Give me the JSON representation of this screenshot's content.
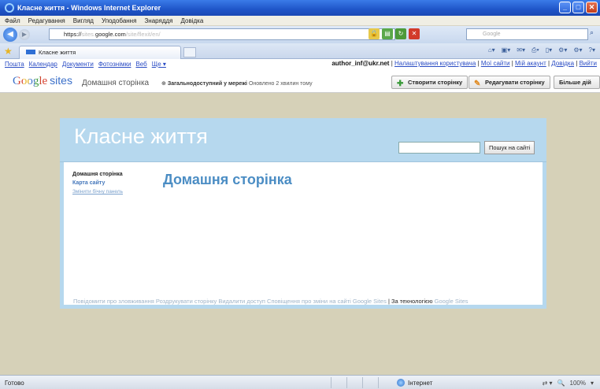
{
  "window": {
    "title": "Класне життя - Windows Internet Explorer",
    "controls": {
      "minimize": "_",
      "maximize": "□",
      "close": "✕"
    }
  },
  "menu": [
    "Файл",
    "Редагування",
    "Вигляд",
    "Уподобання",
    "Знаряддя",
    "Довідка"
  ],
  "address": {
    "scheme": "https://",
    "host_dim": "sites.",
    "host": "google.com",
    "path_dim": "/site/flexit/en/",
    "search_placeholder": "Google"
  },
  "tab": {
    "label": "Класне життя"
  },
  "google_bar": {
    "links": [
      "Пошта",
      "Календар",
      "Документи",
      "Фотознімки",
      "Веб",
      "Ще ▾"
    ],
    "user": "author_inf@ukr.net",
    "right_links": [
      "Налаштування користувача",
      "Мої сайти",
      "Мій акаунт",
      "Довідка",
      "Вийти"
    ]
  },
  "sites_bar": {
    "logo_google": "Google",
    "logo_sites": "sites",
    "home_label": "Домашня сторінка",
    "public_label": "Загальнодоступний у мережі",
    "updated": "Оновлено 2 хвилин тому",
    "create_button": "Створити сторінку",
    "edit_button": "Редагувати сторінку",
    "more_button": "Більше дій ▾"
  },
  "site": {
    "title": "Класне життя",
    "search_button": "Пошук на сайті",
    "nav": {
      "current": "Домашня сторінка",
      "sitemap": "Карта сайту",
      "edit_sidebar": "Змінити бічну панель"
    },
    "page_heading": "Домашня сторінка",
    "footer": {
      "links": "Повідомити про зловживання  Роздрукувати сторінку  Видалити доступ  Сповіщення про зміни на сайті  Google Sites",
      "powered": "За технологією",
      "powered_link": "Google Sites"
    }
  },
  "status": {
    "ready": "Готово",
    "zone": "Інтернет",
    "zoom": "100%"
  }
}
